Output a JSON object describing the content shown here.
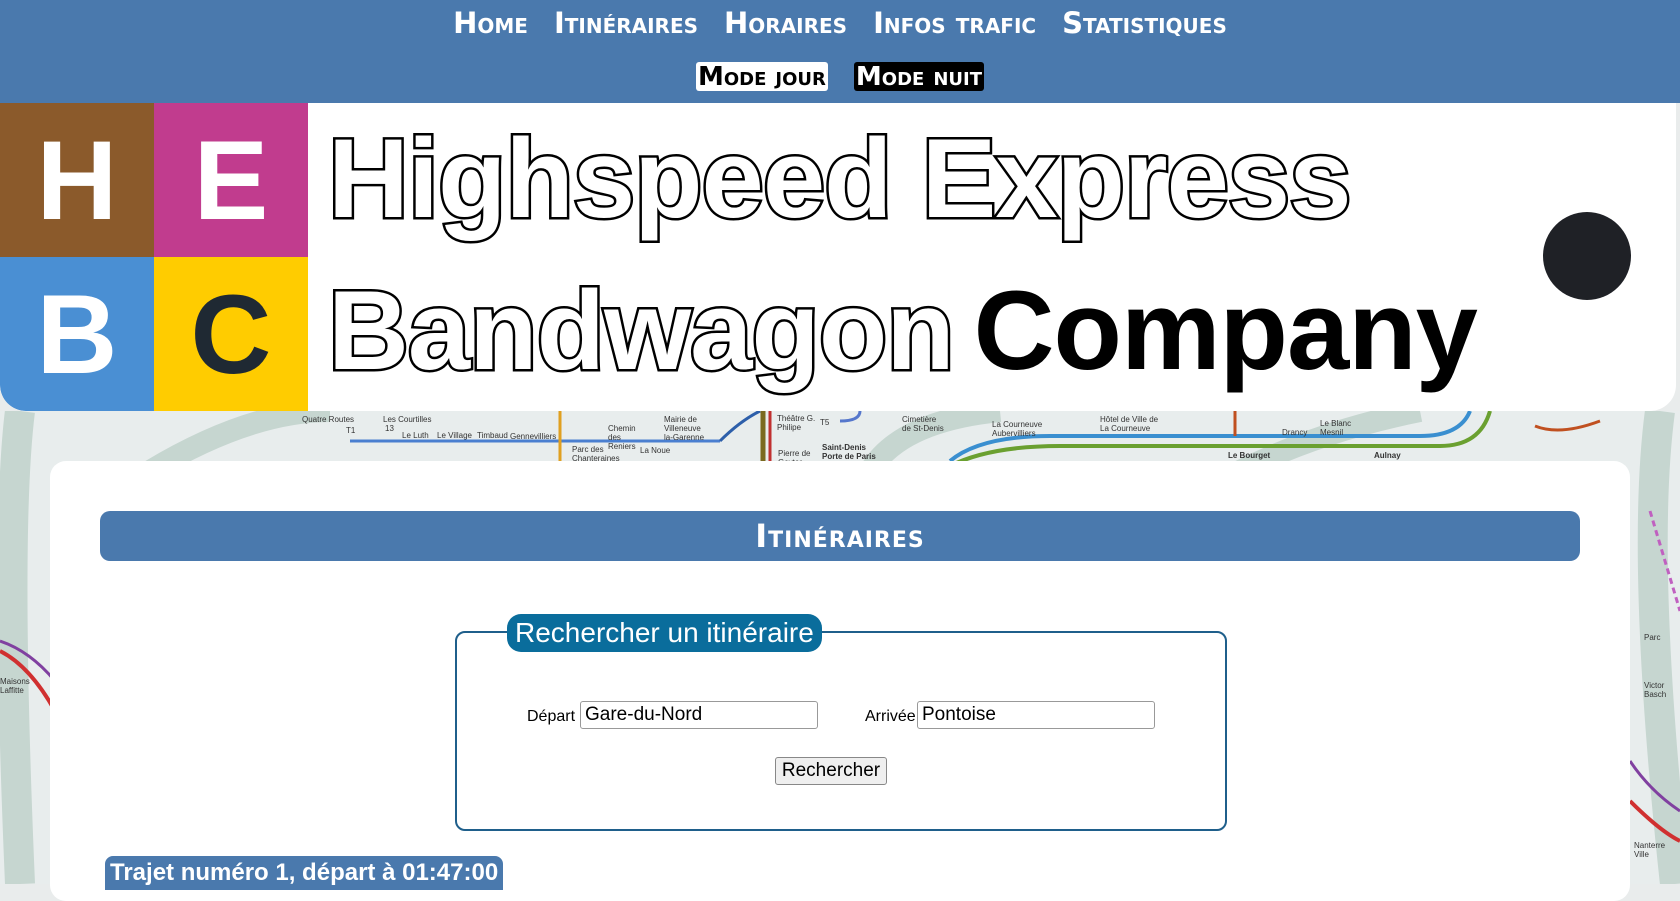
{
  "nav": {
    "items": [
      {
        "label": "Home"
      },
      {
        "label": "Itinéraires"
      },
      {
        "label": "Horaires"
      },
      {
        "label": "Infos trafic"
      },
      {
        "label": "Statistiques"
      }
    ],
    "mode_day_label": "Mode jour",
    "mode_night_label": "Mode nuit"
  },
  "banner": {
    "tiles": [
      "H",
      "E",
      "B",
      "C"
    ],
    "line1": "Highspeed Express",
    "line2_outline": "Bandwagon",
    "line2_solid": "Company"
  },
  "map_labels": [
    "Quatre Routes",
    "Les Courtilles",
    "T1",
    "13",
    "Le Luth",
    "Le Village",
    "Timbaud",
    "Gennevilliers",
    "Chemin des Reniers",
    "Parc des Chanteraines",
    "Mairie de Villeneuve la-Garenne",
    "La Noue",
    "Pierre de Geyter",
    "Théâtre G. Philipe",
    "T5",
    "Saint-Denis Porte de Paris",
    "Cimetière de St-Denis",
    "La Courneuve Aubervilliers",
    "Hôtel de Ville de La Courneuve",
    "Drancy",
    "Le Blanc Mesnil",
    "Le Bourget",
    "Aulnay",
    "Maisons Laffitte",
    "Parc",
    "Victor Basch",
    "Nanterre Ville"
  ],
  "main": {
    "heading": "Itinéraires",
    "search": {
      "legend": "Rechercher un itinéraire",
      "depart_label": "Départ",
      "depart_value": "Gare-du-Nord",
      "arrivee_label": "Arrivée",
      "arrivee_value": "Pontoise",
      "button_label": "Rechercher"
    },
    "trip_title": "Trajet numéro 1, départ à 01:47:00"
  },
  "colors": {
    "nav_bg": "#4a79ad",
    "tile_h": "#8b5a2b",
    "tile_e": "#c13c8e",
    "tile_b": "#4a8fd3",
    "tile_c": "#ffcc00",
    "legend_bg": "#0a6d9c"
  }
}
